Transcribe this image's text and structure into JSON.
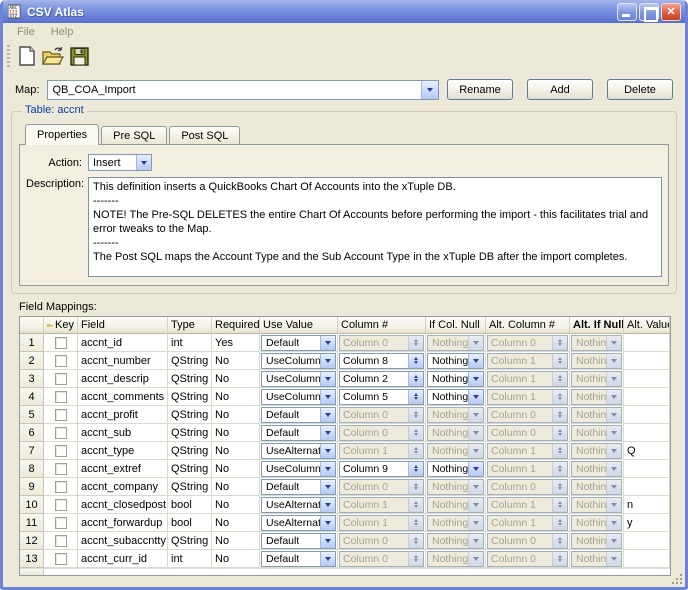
{
  "window": {
    "title": "CSV Atlas"
  },
  "menu": {
    "items": [
      "File",
      "Help"
    ]
  },
  "toolbar": {
    "icons": [
      "new-document-icon",
      "open-folder-icon",
      "save-icon"
    ]
  },
  "map": {
    "label": "Map:",
    "value": "QB_COA_Import",
    "buttons": {
      "rename": "Rename",
      "add": "Add",
      "delete": "Delete"
    }
  },
  "table_group": {
    "legend": "Table: accnt",
    "tabs": [
      {
        "label": "Properties",
        "active": true
      },
      {
        "label": "Pre SQL",
        "active": false
      },
      {
        "label": "Post SQL",
        "active": false
      }
    ],
    "action_label": "Action:",
    "action_value": "Insert",
    "description_label": "Description:",
    "description_text": "This definition inserts a QuickBooks Chart Of Accounts into the xTuple DB.\n-------\nNOTE! The Pre-SQL DELETES the entire Chart Of Accounts before performing the import - this facilitates trial and error tweaks to the Map.\n-------\nThe Post SQL maps the Account Type and the Sub Account Type in the xTuple DB after the import completes."
  },
  "field_mappings": {
    "label": "Field Mappings:",
    "headers": [
      {
        "label": ""
      },
      {
        "label": "Key",
        "icon": "key-icon"
      },
      {
        "label": "Field"
      },
      {
        "label": "Type"
      },
      {
        "label": "Required"
      },
      {
        "label": "Use Value"
      },
      {
        "label": "Column #"
      },
      {
        "label": "If Col. Null"
      },
      {
        "label": "Alt. Column #"
      },
      {
        "label": "Alt. If Null",
        "bold": true
      },
      {
        "label": "Alt. Value"
      }
    ],
    "rows": [
      {
        "num": "1",
        "key_checked": false,
        "field": "accnt_id",
        "type": "int",
        "required": "Yes",
        "use_value": "Default",
        "column": "Column 0",
        "column_enabled": false,
        "if_col_null": "Nothing",
        "if_col_null_enabled": false,
        "alt_column": "Column 0",
        "alt_if_null": "Nothing",
        "alt_value": ""
      },
      {
        "num": "2",
        "key_checked": false,
        "field": "accnt_number",
        "type": "QString",
        "required": "No",
        "use_value": "UseColumn",
        "column": "Column 8",
        "column_enabled": true,
        "if_col_null": "Nothing",
        "if_col_null_enabled": true,
        "alt_column": "Column 1",
        "alt_if_null": "Nothing",
        "alt_value": ""
      },
      {
        "num": "3",
        "key_checked": false,
        "field": "accnt_descrip",
        "type": "QString",
        "required": "No",
        "use_value": "UseColumn",
        "column": "Column 2",
        "column_enabled": true,
        "if_col_null": "Nothing",
        "if_col_null_enabled": true,
        "alt_column": "Column 1",
        "alt_if_null": "Nothing",
        "alt_value": ""
      },
      {
        "num": "4",
        "key_checked": false,
        "field": "accnt_comments",
        "type": "QString",
        "required": "No",
        "use_value": "UseColumn",
        "column": "Column 5",
        "column_enabled": true,
        "if_col_null": "Nothing",
        "if_col_null_enabled": true,
        "alt_column": "Column 1",
        "alt_if_null": "Nothing",
        "alt_value": ""
      },
      {
        "num": "5",
        "key_checked": false,
        "field": "accnt_profit",
        "type": "QString",
        "required": "No",
        "use_value": "Default",
        "column": "Column 0",
        "column_enabled": false,
        "if_col_null": "Nothing",
        "if_col_null_enabled": false,
        "alt_column": "Column 0",
        "alt_if_null": "Nothing",
        "alt_value": ""
      },
      {
        "num": "6",
        "key_checked": false,
        "field": "accnt_sub",
        "type": "QString",
        "required": "No",
        "use_value": "Default",
        "column": "Column 0",
        "column_enabled": false,
        "if_col_null": "Nothing",
        "if_col_null_enabled": false,
        "alt_column": "Column 0",
        "alt_if_null": "Nothing",
        "alt_value": ""
      },
      {
        "num": "7",
        "key_checked": false,
        "field": "accnt_type",
        "type": "QString",
        "required": "No",
        "use_value": "UseAlternate",
        "column": "Column 1",
        "column_enabled": false,
        "if_col_null": "Nothing",
        "if_col_null_enabled": false,
        "alt_column": "Column 1",
        "alt_if_null": "Nothing",
        "alt_value": "Q"
      },
      {
        "num": "8",
        "key_checked": false,
        "field": "accnt_extref",
        "type": "QString",
        "required": "No",
        "use_value": "UseColumn",
        "column": "Column 9",
        "column_enabled": true,
        "if_col_null": "Nothing",
        "if_col_null_enabled": true,
        "alt_column": "Column 1",
        "alt_if_null": "Nothing",
        "alt_value": ""
      },
      {
        "num": "9",
        "key_checked": false,
        "field": "accnt_company",
        "type": "QString",
        "required": "No",
        "use_value": "Default",
        "column": "Column 0",
        "column_enabled": false,
        "if_col_null": "Nothing",
        "if_col_null_enabled": false,
        "alt_column": "Column 0",
        "alt_if_null": "Nothing",
        "alt_value": ""
      },
      {
        "num": "10",
        "key_checked": false,
        "field": "accnt_closedpost",
        "type": "bool",
        "required": "No",
        "use_value": "UseAlternate",
        "column": "Column 1",
        "column_enabled": false,
        "if_col_null": "Nothing",
        "if_col_null_enabled": false,
        "alt_column": "Column 1",
        "alt_if_null": "Nothing",
        "alt_value": "n"
      },
      {
        "num": "11",
        "key_checked": false,
        "field": "accnt_forwardup",
        "type": "bool",
        "required": "No",
        "use_value": "UseAlternate",
        "column": "Column 1",
        "column_enabled": false,
        "if_col_null": "Nothing",
        "if_col_null_enabled": false,
        "alt_column": "Column 1",
        "alt_if_null": "Nothing",
        "alt_value": "y"
      },
      {
        "num": "12",
        "key_checked": false,
        "field": "accnt_subaccntty",
        "type": "QString",
        "required": "No",
        "use_value": "Default",
        "column": "Column 0",
        "column_enabled": false,
        "if_col_null": "Nothing",
        "if_col_null_enabled": false,
        "alt_column": "Column 0",
        "alt_if_null": "Nothing",
        "alt_value": ""
      },
      {
        "num": "13",
        "key_checked": false,
        "field": "accnt_curr_id",
        "type": "int",
        "required": "No",
        "use_value": "Default",
        "column": "Column 0",
        "column_enabled": false,
        "if_col_null": "Nothing",
        "if_col_null_enabled": false,
        "alt_column": "Column 0",
        "alt_if_null": "Nothing",
        "alt_value": ""
      }
    ]
  },
  "colors": {
    "window_bg": "#ece9d8",
    "titlebar_top": "#a5b6ec",
    "titlebar_bottom": "#5570cd",
    "close_button": "#dd5f43",
    "groupbox_legend": "#0b3ea6",
    "control_border": "#7f9db9",
    "disabled_text": "#a5a28e",
    "disabled_bg": "#eeebdc"
  }
}
